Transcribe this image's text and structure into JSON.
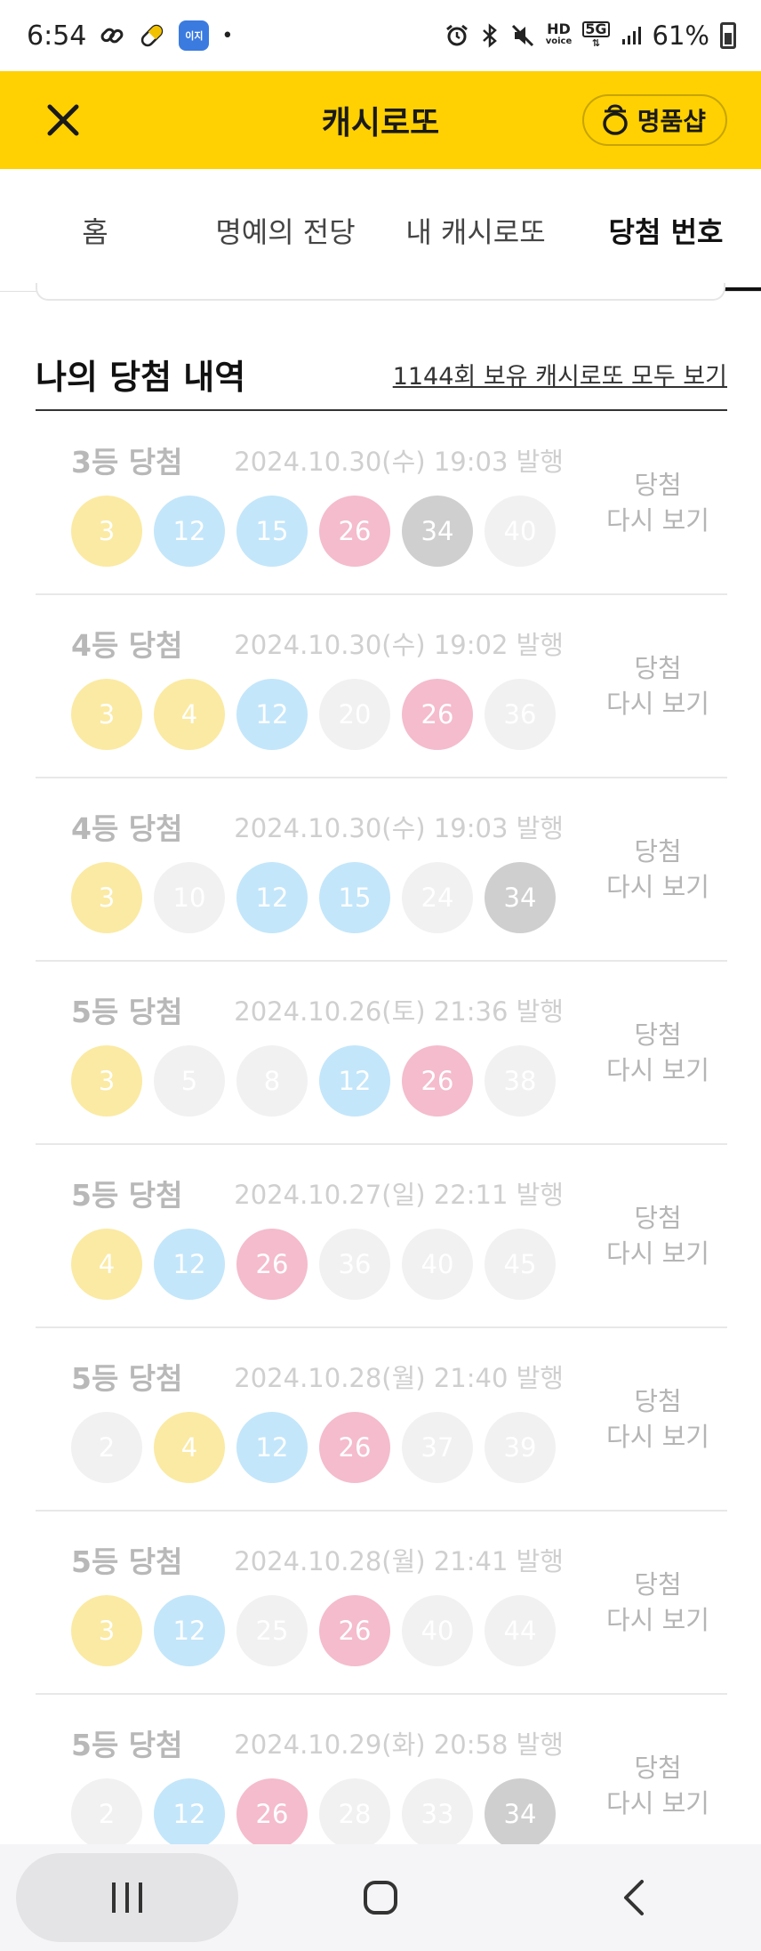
{
  "status_bar": {
    "time": "6:54",
    "app_badge": "이지",
    "dot": "•",
    "hd_line1": "HD",
    "hd_line2": "voice",
    "net": "5G",
    "battery": "61%"
  },
  "header": {
    "title": "캐시로또",
    "shop_label": "명품샵"
  },
  "tabs": [
    {
      "label": "홈",
      "active": false
    },
    {
      "label": "명예의 전당",
      "active": false
    },
    {
      "label": "내 캐시로또",
      "active": false
    },
    {
      "label": "당첨 번호",
      "active": true
    }
  ],
  "section": {
    "title": "나의 당첨 내역",
    "link": "1144회 보유 캐시로또 모두 보기"
  },
  "action_line1": "당첨",
  "action_line2": "다시 보기",
  "wins": [
    {
      "rank": "3등 당첨",
      "issued": "2024.10.30(수) 19:03 발행",
      "balls": [
        {
          "n": "3",
          "c": "yellow"
        },
        {
          "n": "12",
          "c": "blue"
        },
        {
          "n": "15",
          "c": "blue"
        },
        {
          "n": "26",
          "c": "red"
        },
        {
          "n": "34",
          "c": "gray"
        },
        {
          "n": "40",
          "c": "dim"
        }
      ]
    },
    {
      "rank": "4등 당첨",
      "issued": "2024.10.30(수) 19:02 발행",
      "balls": [
        {
          "n": "3",
          "c": "yellow"
        },
        {
          "n": "4",
          "c": "yellow"
        },
        {
          "n": "12",
          "c": "blue"
        },
        {
          "n": "20",
          "c": "dim"
        },
        {
          "n": "26",
          "c": "red"
        },
        {
          "n": "36",
          "c": "dim"
        }
      ]
    },
    {
      "rank": "4등 당첨",
      "issued": "2024.10.30(수) 19:03 발행",
      "balls": [
        {
          "n": "3",
          "c": "yellow"
        },
        {
          "n": "10",
          "c": "dim"
        },
        {
          "n": "12",
          "c": "blue"
        },
        {
          "n": "15",
          "c": "blue"
        },
        {
          "n": "24",
          "c": "dim"
        },
        {
          "n": "34",
          "c": "gray"
        }
      ]
    },
    {
      "rank": "5등 당첨",
      "issued": "2024.10.26(토) 21:36 발행",
      "balls": [
        {
          "n": "3",
          "c": "yellow"
        },
        {
          "n": "5",
          "c": "dim"
        },
        {
          "n": "8",
          "c": "dim"
        },
        {
          "n": "12",
          "c": "blue"
        },
        {
          "n": "26",
          "c": "red"
        },
        {
          "n": "38",
          "c": "dim"
        }
      ]
    },
    {
      "rank": "5등 당첨",
      "issued": "2024.10.27(일) 22:11 발행",
      "balls": [
        {
          "n": "4",
          "c": "yellow"
        },
        {
          "n": "12",
          "c": "blue"
        },
        {
          "n": "26",
          "c": "red"
        },
        {
          "n": "36",
          "c": "dim"
        },
        {
          "n": "40",
          "c": "dim"
        },
        {
          "n": "45",
          "c": "dim"
        }
      ]
    },
    {
      "rank": "5등 당첨",
      "issued": "2024.10.28(월) 21:40 발행",
      "balls": [
        {
          "n": "2",
          "c": "dim"
        },
        {
          "n": "4",
          "c": "yellow"
        },
        {
          "n": "12",
          "c": "blue"
        },
        {
          "n": "26",
          "c": "red"
        },
        {
          "n": "37",
          "c": "dim"
        },
        {
          "n": "39",
          "c": "dim"
        }
      ]
    },
    {
      "rank": "5등 당첨",
      "issued": "2024.10.28(월) 21:41 발행",
      "balls": [
        {
          "n": "3",
          "c": "yellow"
        },
        {
          "n": "12",
          "c": "blue"
        },
        {
          "n": "25",
          "c": "dim"
        },
        {
          "n": "26",
          "c": "red"
        },
        {
          "n": "40",
          "c": "dim"
        },
        {
          "n": "44",
          "c": "dim"
        }
      ]
    },
    {
      "rank": "5등 당첨",
      "issued": "2024.10.29(화) 20:58 발행",
      "balls": [
        {
          "n": "2",
          "c": "dim"
        },
        {
          "n": "12",
          "c": "blue"
        },
        {
          "n": "26",
          "c": "red"
        },
        {
          "n": "28",
          "c": "dim"
        },
        {
          "n": "33",
          "c": "dim"
        },
        {
          "n": "34",
          "c": "gray"
        }
      ]
    }
  ],
  "colors": {
    "brand_yellow": "#ffd102",
    "ball_yellow": "#fbeaa3",
    "ball_blue": "#c3e6fa",
    "ball_red": "#f4bccd",
    "ball_gray": "#cfcfcf"
  }
}
